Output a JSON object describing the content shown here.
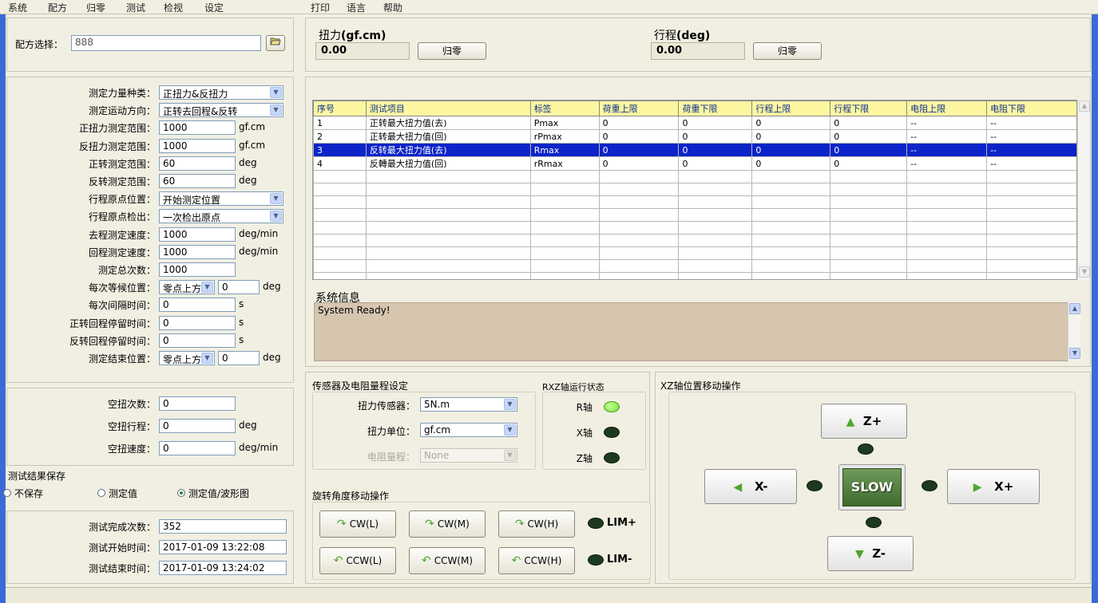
{
  "menu": [
    "系统",
    "配方",
    "归零",
    "测试",
    "检视",
    "设定",
    "打印",
    "语言",
    "帮助"
  ],
  "recipe": {
    "label": "配方选择：",
    "value": "888"
  },
  "torque_display": {
    "label_prefix": "扭力",
    "label_unit": "(gf.cm)",
    "value": "0.00",
    "zero_button": "归零"
  },
  "travel_display": {
    "label_prefix": "行程",
    "label_unit": "(deg)",
    "value": "0.00",
    "zero_button": "归零"
  },
  "params": [
    {
      "label": "测定力量种类：",
      "type": "select",
      "value": "正扭力&反扭力"
    },
    {
      "label": "测定运动方向：",
      "type": "select",
      "value": "正转去回程&反转"
    },
    {
      "label": "正扭力测定范围：",
      "type": "input",
      "value": "1000",
      "unit": "gf.cm"
    },
    {
      "label": "反扭力测定范围：",
      "type": "input",
      "value": "1000",
      "unit": "gf.cm"
    },
    {
      "label": "正转测定范围：",
      "type": "input",
      "value": "60",
      "unit": "deg"
    },
    {
      "label": "反转测定范围：",
      "type": "input",
      "value": "60",
      "unit": "deg"
    },
    {
      "label": "行程原点位置：",
      "type": "select",
      "value": "开始测定位置"
    },
    {
      "label": "行程原点检出：",
      "type": "select",
      "value": "一次检出原点"
    },
    {
      "label": "去程测定速度：",
      "type": "input",
      "value": "1000",
      "unit": "deg/min"
    },
    {
      "label": "回程测定速度：",
      "type": "input",
      "value": "1000",
      "unit": "deg/min"
    },
    {
      "label": "测定总次数：",
      "type": "input",
      "value": "1000",
      "unit": ""
    },
    {
      "label": "每次等候位置：",
      "type": "selinput",
      "value": "零点上方",
      "value2": "0",
      "unit": "deg"
    },
    {
      "label": "每次间隔时间：",
      "type": "input",
      "value": "0",
      "unit": "s"
    },
    {
      "label": "正转回程停留时间：",
      "type": "input",
      "value": "0",
      "unit": "s"
    },
    {
      "label": "反转回程停留时间：",
      "type": "input",
      "value": "0",
      "unit": "s"
    },
    {
      "label": "测定结束位置：",
      "type": "selinput",
      "value": "零点上方",
      "value2": "0",
      "unit": "deg"
    }
  ],
  "idle": [
    {
      "label": "空扭次数：",
      "value": "0",
      "unit": ""
    },
    {
      "label": "空扭行程：",
      "value": "0",
      "unit": "deg"
    },
    {
      "label": "空扭速度：",
      "value": "0",
      "unit": "deg/min"
    }
  ],
  "save": {
    "title": "测试结果保存",
    "options": [
      "不保存",
      "测定值",
      "测定值/波形图"
    ],
    "selected_index": 2
  },
  "stats": [
    {
      "label": "测试完成次数：",
      "value": "352"
    },
    {
      "label": "测试开始时间：",
      "value": "2017-01-09 13:22:08"
    },
    {
      "label": "测试结束时间：",
      "value": "2017-01-09 13:24:02"
    }
  ],
  "table": {
    "headers": [
      "序号",
      "测试项目",
      "标签",
      "荷重上限",
      "荷重下限",
      "行程上限",
      "行程下限",
      "电阻上限",
      "电阻下限"
    ],
    "rows": [
      [
        "1",
        "正转最大扭力值(去)",
        "Pmax",
        "0",
        "0",
        "0",
        "0",
        "--",
        "--"
      ],
      [
        "2",
        "正转最大扭力值(回)",
        "rPmax",
        "0",
        "0",
        "0",
        "0",
        "--",
        "--"
      ],
      [
        "3",
        "反转最大扭力值(去)",
        "Rmax",
        "0",
        "0",
        "0",
        "0",
        "--",
        "--"
      ],
      [
        "4",
        "反轉最大扭力值(回)",
        "rRmax",
        "0",
        "0",
        "0",
        "0",
        "--",
        "--"
      ]
    ],
    "selected_row": 2,
    "empty_rows": 9
  },
  "sysinfo": {
    "title": "系统信息",
    "text": "System Ready!"
  },
  "sensor": {
    "title": "传感器及电阻量程设定",
    "torque_sensor_label": "扭力传感器：",
    "torque_sensor_value": "5N.m",
    "unit_label": "扭力单位：",
    "unit_value": "gf.cm",
    "resistance_label": "电阻量程：",
    "resistance_value": "None"
  },
  "axis_status": {
    "title": "RXZ轴运行状态",
    "axes": [
      {
        "label": "R轴",
        "on": true
      },
      {
        "label": "X轴",
        "on": false
      },
      {
        "label": "Z轴",
        "on": false
      }
    ]
  },
  "rotate": {
    "title": "旋转角度移动操作",
    "cw": [
      "CW(L)",
      "CW(M)",
      "CW(H)"
    ],
    "ccw": [
      "CCW(L)",
      "CCW(M)",
      "CCW(H)"
    ],
    "lim_plus": "LIM+",
    "lim_minus": "LIM-"
  },
  "xz": {
    "title": "XZ轴位置移动操作",
    "z_plus": "Z+",
    "z_minus": "Z-",
    "x_minus": "X-",
    "x_plus": "X+",
    "slow": "SLOW"
  },
  "colors": {
    "selection": "#0c24c8",
    "header_bg": "#fdf6a1",
    "window_border": "#3a6ad8",
    "led_on": "#6fe02d",
    "sysinfo_bg": "#d6c6b0"
  }
}
